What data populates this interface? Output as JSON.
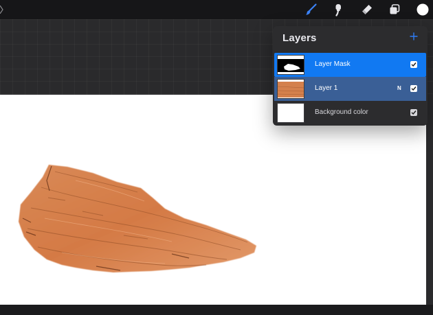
{
  "toolbar": {
    "tools": [
      {
        "name": "brush-icon",
        "active": true
      },
      {
        "name": "smudge-icon",
        "active": false
      },
      {
        "name": "eraser-icon",
        "active": false
      },
      {
        "name": "layers-icon",
        "active": false
      },
      {
        "name": "color-swatch",
        "active": false
      }
    ],
    "active_color": "#3b82f6",
    "icon_color": "#e6e6ea",
    "swatch_color": "#ffffff"
  },
  "layers_panel": {
    "title": "Layers",
    "add_icon": "plus-icon",
    "layers": [
      {
        "name": "Layer Mask",
        "blend_mode": "",
        "visible": true,
        "selected": true
      },
      {
        "name": "Layer 1",
        "blend_mode": "N",
        "visible": true,
        "selected": false
      },
      {
        "name": "Background color",
        "blend_mode": "",
        "visible": true,
        "selected": false
      }
    ]
  },
  "canvas": {
    "background": "#ffffff",
    "subject": "wood-piece"
  },
  "colors": {
    "selected_layer": "#1179f2",
    "secondary_layer": "#3a5f96",
    "panel": "#2c2c2e",
    "wood": "#d9834f"
  }
}
